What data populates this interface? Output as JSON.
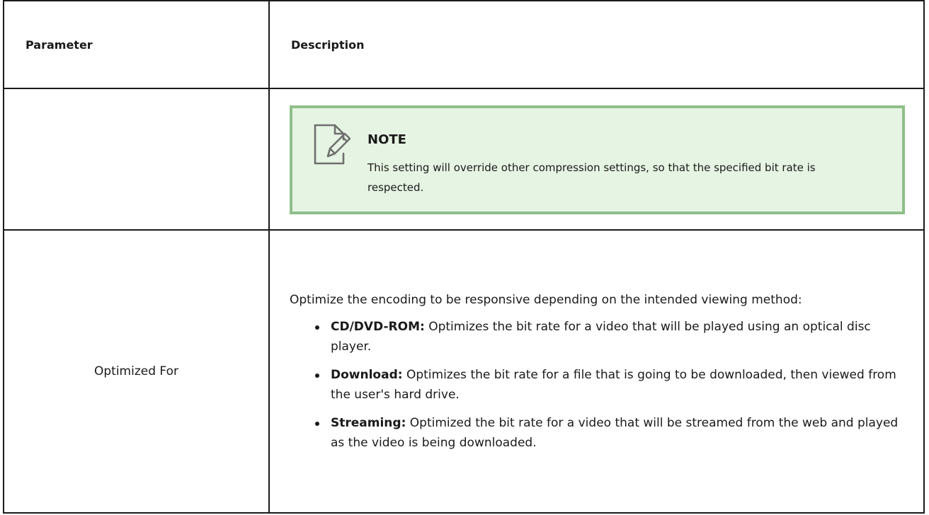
{
  "table": {
    "headers": {
      "parameter": "Parameter",
      "description": "Description"
    },
    "note_row": {
      "parameter": "",
      "note": {
        "icon": "note-pencil-icon",
        "title": "NOTE",
        "text": "This setting will override other compression settings, so that the specified bit rate is respected."
      }
    },
    "optimized_row": {
      "parameter": "Optimized For",
      "intro": "Optimize the encoding to be responsive depending on the intended viewing method:",
      "items": [
        {
          "term": "CD/DVD-ROM:",
          "text": " Optimizes the bit rate for a video that will be played using an optical disc player."
        },
        {
          "term": "Download:",
          "text": " Optimizes the bit rate for a file that is going to be downloaded, then viewed from the user's hard drive."
        },
        {
          "term": "Streaming:",
          "text": " Optimized the bit rate for a video that will be streamed from the web and played as the video is being downloaded."
        }
      ]
    }
  },
  "colors": {
    "note_background": "#e6f5e3",
    "note_border": "#8fbf8a",
    "table_border": "#1a1a1a"
  }
}
